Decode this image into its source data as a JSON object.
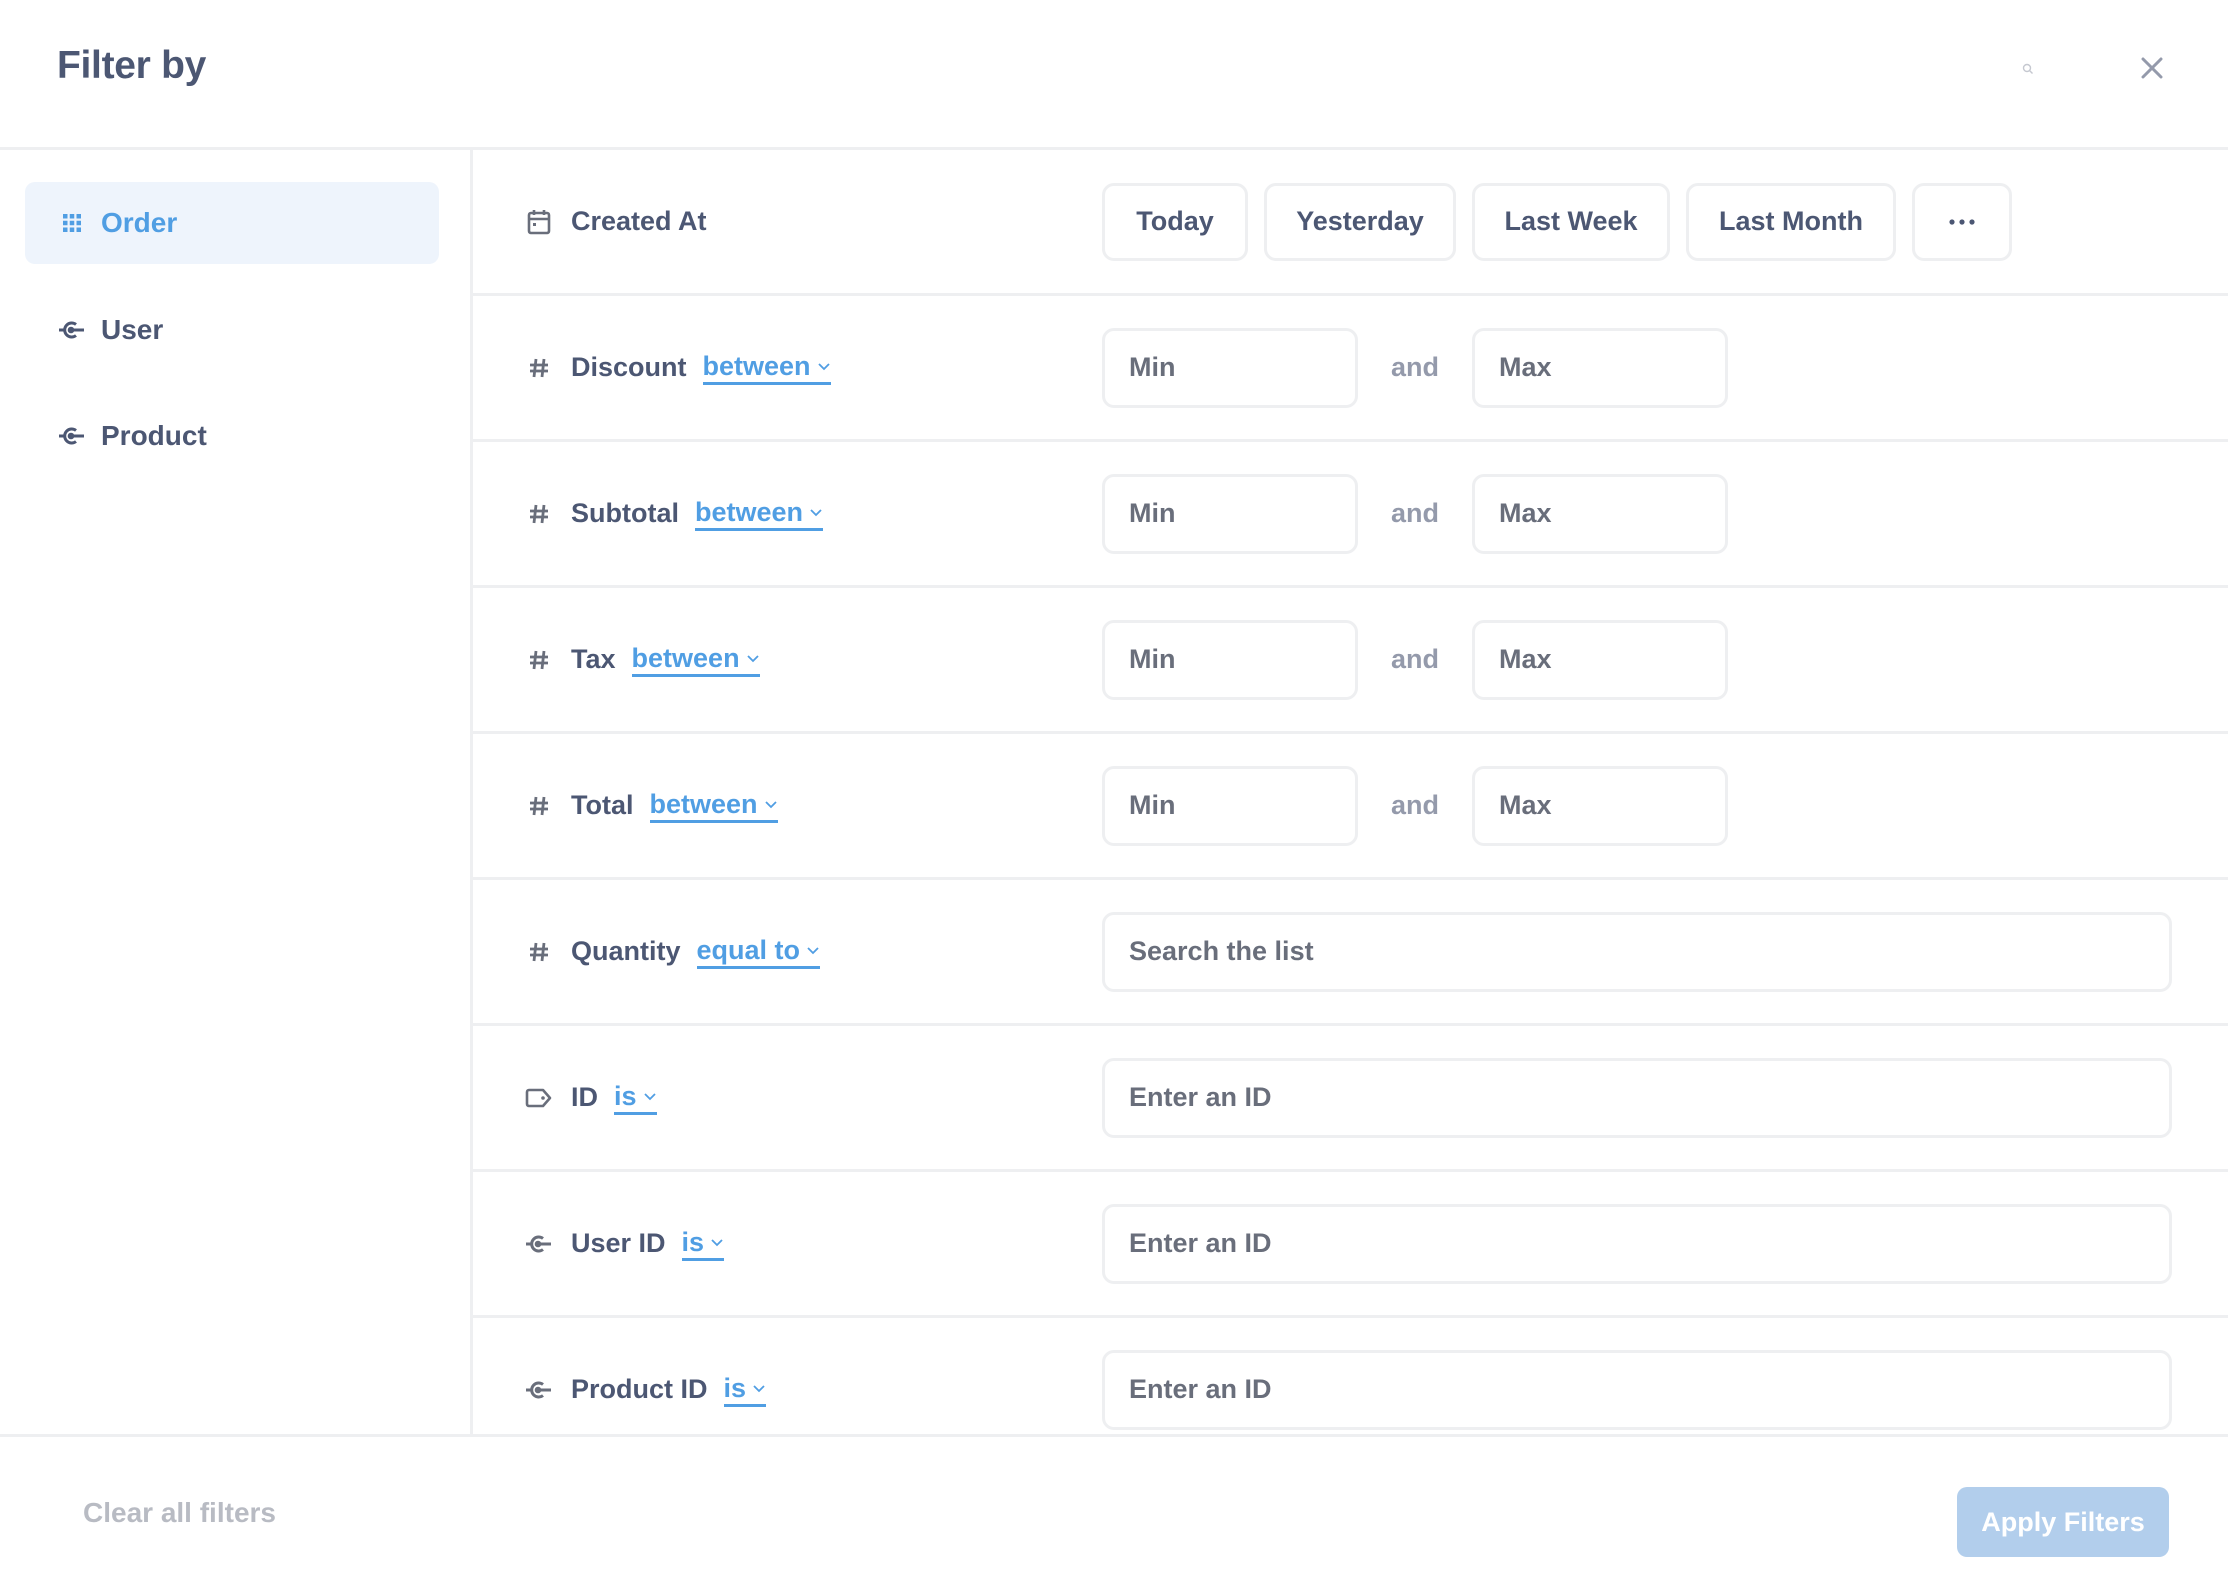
{
  "header": {
    "title": "Filter by",
    "search_icon": "search-icon",
    "close_icon": "close-icon"
  },
  "sidebar": {
    "items": [
      {
        "label": "Order",
        "icon": "grid-icon",
        "active": true
      },
      {
        "label": "User",
        "icon": "foreign-key-icon",
        "active": false
      },
      {
        "label": "Product",
        "icon": "foreign-key-icon",
        "active": false
      }
    ]
  },
  "filters": {
    "created_at": {
      "label": "Created At",
      "icon": "calendar-icon",
      "shortcuts": [
        "Today",
        "Yesterday",
        "Last Week",
        "Last Month"
      ],
      "more_label": "..."
    },
    "rows": [
      {
        "label": "Discount",
        "icon": "hash-icon",
        "operator": "between",
        "min_placeholder": "Min",
        "and_label": "and",
        "max_placeholder": "Max"
      },
      {
        "label": "Subtotal",
        "icon": "hash-icon",
        "operator": "between",
        "min_placeholder": "Min",
        "and_label": "and",
        "max_placeholder": "Max"
      },
      {
        "label": "Tax",
        "icon": "hash-icon",
        "operator": "between",
        "min_placeholder": "Min",
        "and_label": "and",
        "max_placeholder": "Max"
      },
      {
        "label": "Total",
        "icon": "hash-icon",
        "operator": "between",
        "min_placeholder": "Min",
        "and_label": "and",
        "max_placeholder": "Max"
      }
    ],
    "quantity": {
      "label": "Quantity",
      "icon": "hash-icon",
      "operator": "equal to",
      "placeholder": "Search the list"
    },
    "id_rows": [
      {
        "label": "ID",
        "icon": "tag-icon",
        "operator": "is",
        "placeholder": "Enter an ID"
      },
      {
        "label": "User ID",
        "icon": "foreign-key-icon",
        "operator": "is",
        "placeholder": "Enter an ID"
      },
      {
        "label": "Product ID",
        "icon": "foreign-key-icon",
        "operator": "is",
        "placeholder": "Enter an ID"
      }
    ]
  },
  "footer": {
    "clear_label": "Clear all filters",
    "apply_label": "Apply Filters"
  },
  "colors": {
    "brand": "#509EE3",
    "text_dark": "#4C5773",
    "text_medium": "#696E7B",
    "text_light": "#949AAB",
    "border": "#EEEFF1",
    "active_bg": "#EEF4FC",
    "apply_disabled_bg": "#B2CEEC"
  }
}
